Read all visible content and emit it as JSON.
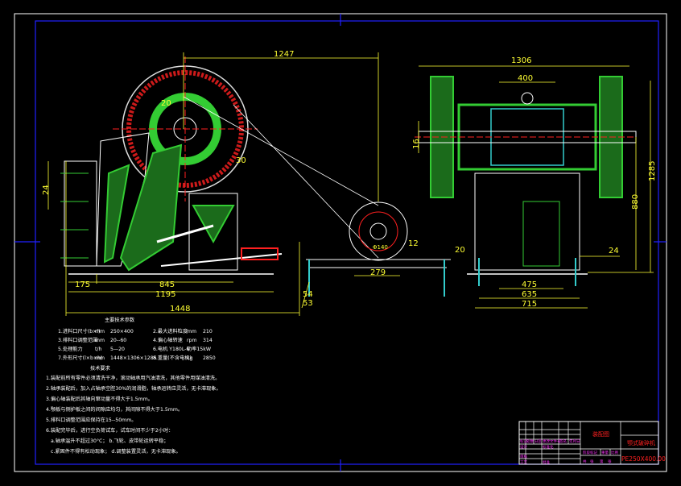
{
  "drawing": {
    "colors": {
      "background": "#000000",
      "frame": "#ffffff",
      "border": "#2020ff",
      "dimension": "#ffff33",
      "part": "#33cc33",
      "centerline": "#ff2020",
      "title_block": "#ff33ff"
    },
    "side_view_dims": {
      "overall_height_link": "1247",
      "rib": "20",
      "gap": "30",
      "left_offset": "24",
      "base_left": "175",
      "base_mid": "845",
      "base_total": "1195",
      "overall_length": "1448",
      "motor_base": "279",
      "motor_gap": "12",
      "motor_edge": "20",
      "rail_a": "54",
      "rail_b": "53",
      "pulley_dia": "Φ140"
    },
    "front_view_dims": {
      "overall_width": "1306",
      "bearing_span": "400",
      "shaft_offset": "16",
      "foot_inner": "475",
      "foot_mid": "635",
      "foot_outer": "715",
      "foot_edge": "24",
      "overall_height": "1285",
      "shaft_height": "880"
    }
  },
  "parameters": {
    "title": "主要技术参数",
    "rows": [
      [
        "1.进料口尺寸(b×l)",
        "mm",
        "250×400",
        "2.最大进料粒度",
        "mm",
        "210"
      ],
      [
        "3.排料口调整范围",
        "mm",
        "20--60",
        "4.偏心轴转速",
        "rpm",
        "314"
      ],
      [
        "5.处理能力",
        "t/h",
        "5—20",
        "6.电机 Y180L-6",
        "功率15kW",
        ""
      ],
      [
        "7.外形尺寸(l×b×h)",
        "mm",
        "1448×1306×1285",
        "8.重量(不含电机)",
        "kg",
        "2850"
      ]
    ]
  },
  "requirements": {
    "title": "技术要求",
    "items": [
      "1.装配前所有零件必须清洗干净，滚动轴承用汽油清洗，其他零件用煤油清洗。",
      "2.轴承装配后，加入占轴承空腔30%的润滑脂，轴承运转应灵活，无卡滞现象。",
      "3.偏心轴装配后其轴向窜动量不得大于1.5mm。",
      "4.颚板与侧护板之间的间隙应均匀，其间隙不得大于1.5mm。",
      "5.排料口调整范围应保持在15--50mm。",
      "6.装配完毕后，进行空负荷试车，试车时间不少于2小时：",
      "a.轴承温升不超过30°C；   b.飞轮、皮带轮运转平稳；",
      "c.紧固件不得有松动现象；   d.调整装置灵活，无卡滞现象。"
    ]
  },
  "title_block": {
    "drawing_type": "装配图",
    "name": "颚式破碎机",
    "code": "PE250X400.00",
    "labels": [
      "标记",
      "处数",
      "分区",
      "更改文件号",
      "签名",
      "年月日",
      "设计",
      "标准化",
      "审核",
      "工艺",
      "批准",
      "阶段标记",
      "重量",
      "比例",
      "共",
      "张",
      "第",
      "张"
    ]
  }
}
